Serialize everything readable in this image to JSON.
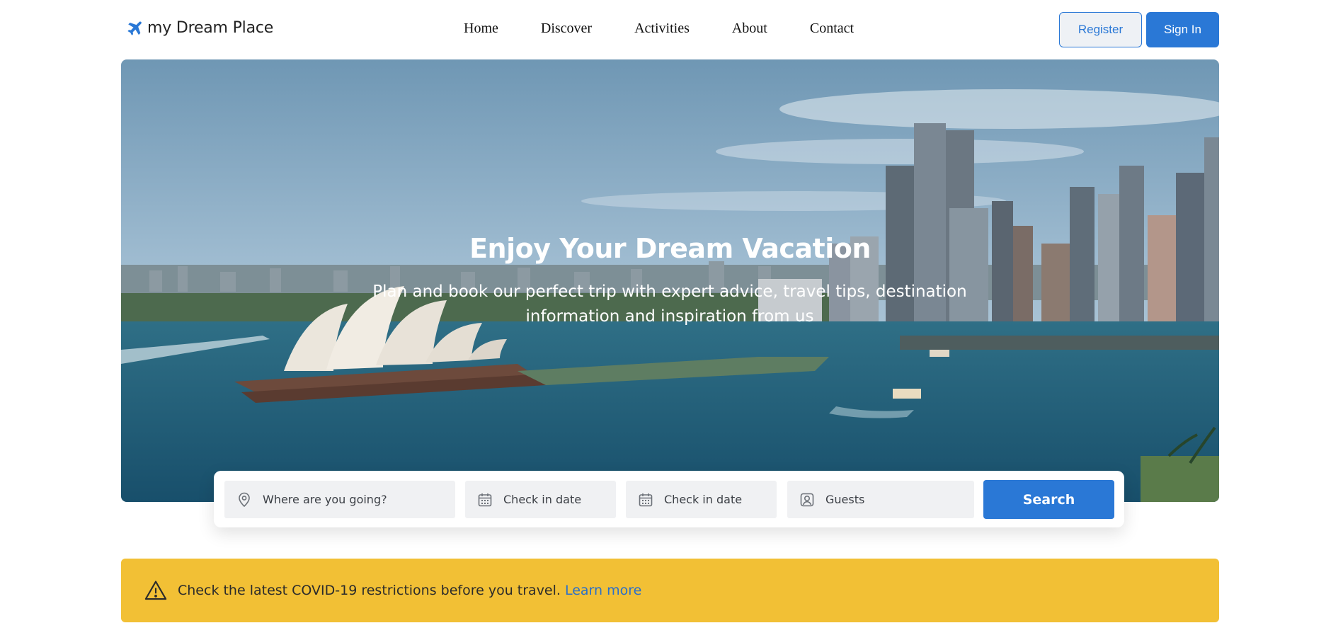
{
  "header": {
    "logo_text": "my Dream Place",
    "logo_icon": "airplane-icon",
    "nav": [
      {
        "label": "Home"
      },
      {
        "label": "Discover"
      },
      {
        "label": "Activities"
      },
      {
        "label": "About"
      },
      {
        "label": "Contact"
      }
    ],
    "register_label": "Register",
    "signin_label": "Sign In"
  },
  "hero": {
    "title": "Enjoy Your Dream Vacation",
    "subtitle": "Plan and book our perfect trip with expert advice, travel tips, destination information and inspiration from us"
  },
  "search": {
    "where_placeholder": "Where are you going?",
    "checkin_placeholder": "Check in date",
    "checkout_placeholder": "Check in date",
    "guests_placeholder": "Guests",
    "button_label": "Search"
  },
  "alert": {
    "text": "Check the latest COVID-19 restrictions before you travel.",
    "link_label": "Learn more"
  },
  "colors": {
    "brand": "#2a78d6",
    "alert_bg": "#f2c035",
    "link": "#2a6fc9"
  }
}
